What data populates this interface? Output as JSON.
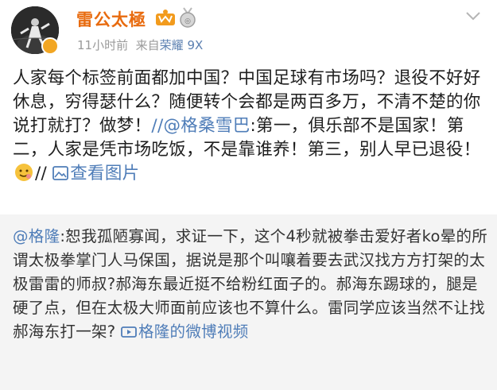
{
  "post": {
    "username": "雷公太極",
    "time": "11小时前",
    "source_prefix": "来自",
    "source_brand": "荣耀",
    "source_model": "9X",
    "text_part1": "人家每个标签前面都加中国？中国足球有市场吗？退役不好好休息，穷得瑟什么？随便转个会都是两百多万，不清不楚的你说打就打？做梦！",
    "mention1": "//@格桑雪巴",
    "text_part2": ":第一，俱乐部不是国家！第二，人家是凭市场吃饭，不是靠谁养！第三，别人早已退役！",
    "slashes": "//",
    "view_pics": "查看图片"
  },
  "repost": {
    "mention": "@格隆",
    "text": ":恕我孤陋寡闻，求证一下，这个4秒就被拳击爱好者ko晕的所谓太极拳掌门人马保国，据说是那个叫嚷着要去武汉找方方打架的太极雷雷的师叔?郝海东最近挺不给粉红面子的。郝海东踢球的，腿是硬了点，但在太极大师面前应该也不算什么。雷同学应该当然不让找郝海东打一架?",
    "video_link": "格隆的微博视频"
  },
  "colors": {
    "username": "#e86b0f",
    "link": "#4f7db8",
    "repost_bg": "#f4f4f4"
  },
  "icons": [
    "avatar",
    "vip-crown-icon",
    "medal-icon",
    "chevron-down-icon",
    "emoji-icon",
    "picture-icon",
    "video-icon"
  ]
}
